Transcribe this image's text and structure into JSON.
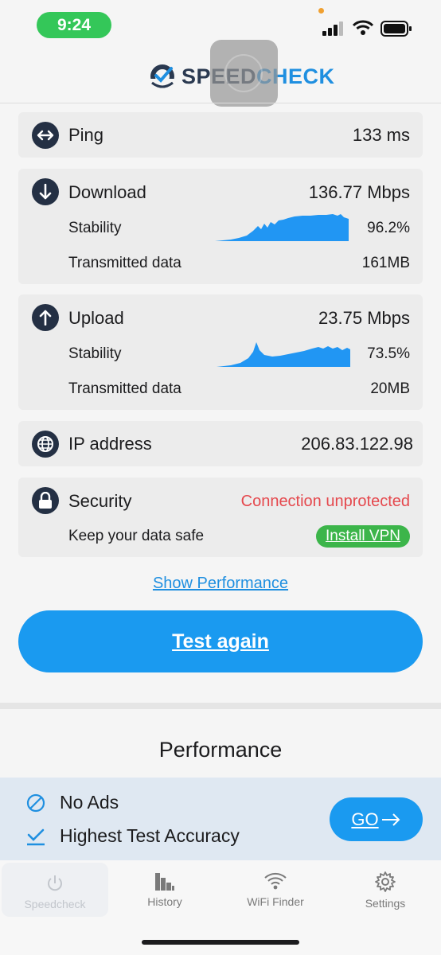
{
  "status_bar": {
    "time": "9:24"
  },
  "header": {
    "logo_part1": "SPEED",
    "logo_part2": "CHECK"
  },
  "ping": {
    "title": "Ping",
    "value": "133 ms",
    "icon": "left-right-arrows-icon"
  },
  "download": {
    "title": "Download",
    "value": "136.77 Mbps",
    "icon": "arrow-down-icon",
    "stability_label": "Stability",
    "stability_value": "96.2%",
    "data_label": "Transmitted data",
    "data_value": "161MB"
  },
  "upload": {
    "title": "Upload",
    "value": "23.75 Mbps",
    "icon": "arrow-up-icon",
    "stability_label": "Stability",
    "stability_value": "73.5%",
    "data_label": "Transmitted data",
    "data_value": "20MB"
  },
  "ip": {
    "title": "IP address",
    "value": "206.83.122.98",
    "icon": "globe-icon"
  },
  "security": {
    "title": "Security",
    "status": "Connection unprotected",
    "icon": "lock-icon",
    "hint": "Keep your data safe",
    "button": "Install VPN"
  },
  "actions": {
    "show_performance": "Show Performance",
    "test_again": "Test again"
  },
  "performance": {
    "title": "Performance"
  },
  "promo": {
    "item1": "No Ads",
    "item2": "Highest Test Accuracy",
    "button": "GO"
  },
  "tabs": [
    {
      "label": "Speedcheck",
      "icon": "power-icon",
      "active": true
    },
    {
      "label": "History",
      "icon": "bar-chart-icon",
      "active": false
    },
    {
      "label": "WiFi Finder",
      "icon": "wifi-icon",
      "active": false
    },
    {
      "label": "Settings",
      "icon": "gear-icon",
      "active": false
    }
  ],
  "colors": {
    "accent": "#1a9af0",
    "warning": "#e5484d",
    "vpn": "#3cb54a",
    "icon_bg": "#243044"
  }
}
